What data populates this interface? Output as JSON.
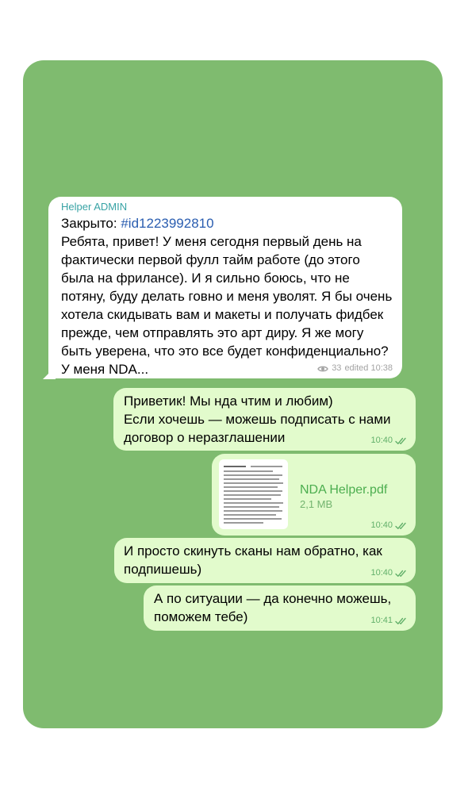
{
  "chat": {
    "incoming": {
      "sender": "Helper ADMIN",
      "closed_label": "Закрыто: ",
      "hashtag": "#id1223992810",
      "text": "Ребята, привет! У меня сегодня первый день на фактически первой фулл тайм работе (до этого была на фрилансе). И я сильно боюсь, что не потяну, буду делать говно и меня уволят. Я бы очень хотела скидывать вам и макеты и получать фидбек прежде, чем отправлять это арт диру. Я же могу быть уверена, что это все будет конфиденциально? У меня NDA...",
      "views": "33",
      "edited_time": "edited 10:38"
    },
    "outgoing": [
      {
        "text": "Приветик! Мы нда чтим и любим)\nЕсли хочешь — можешь подписать с нами договор о неразглашении",
        "time": "10:40"
      },
      {
        "file_name": "NDA Helper.pdf",
        "file_size": "2,1 MB",
        "time": "10:40"
      },
      {
        "text": "И просто скинуть сканы нам обратно, как подпишешь)",
        "time": "10:40"
      },
      {
        "text": "А по ситуации — да конечно можешь, поможем тебе)",
        "time": "10:41"
      }
    ]
  },
  "colors": {
    "background": "#7fbb6f",
    "incoming_bubble": "#ffffff",
    "outgoing_bubble": "#e2fbcc",
    "sender_name": "#38a3a5",
    "hashtag": "#2a5db0",
    "status": "#62b06a"
  },
  "icons": {
    "views": "eye-icon",
    "read_status": "double-check-icon",
    "document": "pdf-thumbnail"
  }
}
